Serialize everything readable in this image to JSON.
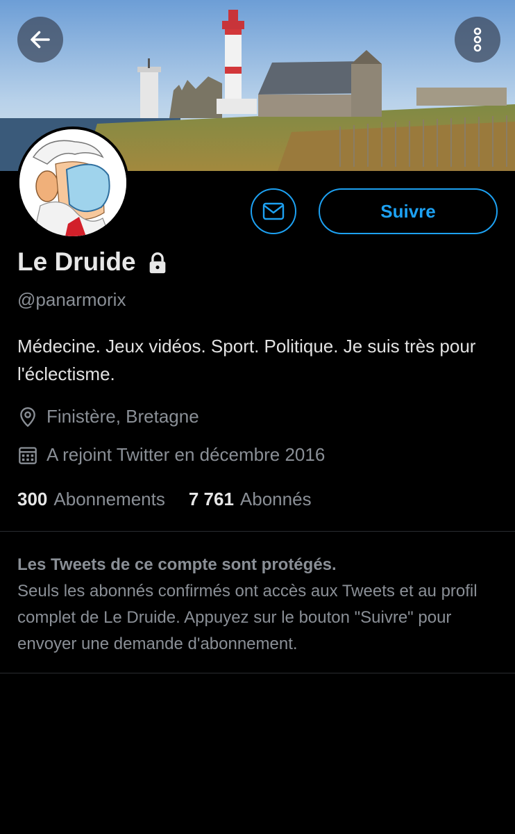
{
  "header": {
    "back_icon": "arrow-left-icon",
    "more_icon": "more-vertical-icon"
  },
  "profile": {
    "name": "Le Druide",
    "lock_icon": "lock-icon",
    "handle": "@panarmorix",
    "bio": "Médecine. Jeux vidéos. Sport. Politique. Je suis très pour l'éclectisme.",
    "location": "Finistère, Bretagne",
    "joined": "A rejoint Twitter en décembre 2016",
    "following_count": "300",
    "following_label": "Abonnements",
    "followers_count": "7 761",
    "followers_label": "Abonnés"
  },
  "actions": {
    "message_icon": "mail-icon",
    "follow_label": "Suivre"
  },
  "protected_notice": {
    "title": "Les Tweets de ce compte sont protégés.",
    "body": "Seuls les abonnés confirmés ont accès aux Tweets et au profil complet de Le Druide. Appuyez sur le bouton \"Suivre\" pour envoyer une demande d'abonnement."
  },
  "colors": {
    "accent": "#1da1f2",
    "background": "#000000",
    "secondary_text": "#8a8f96"
  }
}
